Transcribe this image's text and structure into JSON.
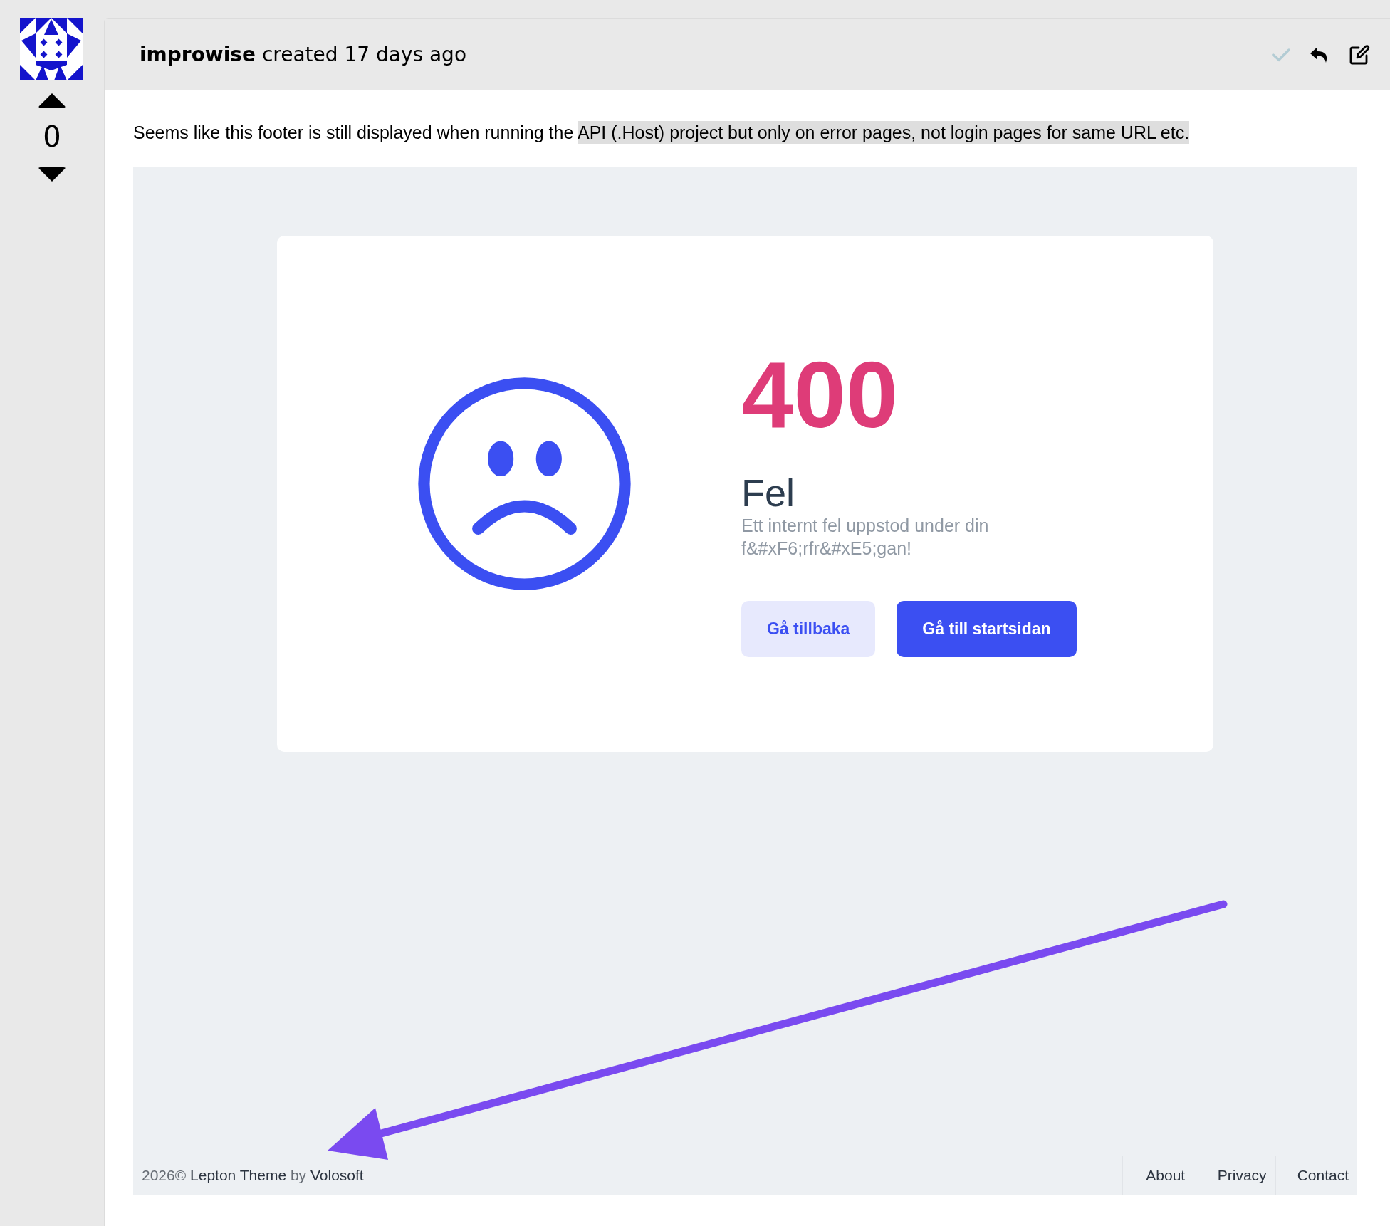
{
  "sidebar": {
    "score": "0"
  },
  "post": {
    "author": "improwise",
    "meta": "created 17 days ago",
    "accepted": false,
    "text": "Seems like this footer is still displayed when running the ",
    "highlight": "API (.Host) project but only on error pages, not login pages for same URL etc."
  },
  "screenshot": {
    "code": "400",
    "title": "Fel",
    "message": "Ett internt fel uppstod under din f&#xF6;rfr&#xE5;gan!",
    "buttons": [
      {
        "label": "Gå tillbaka",
        "kind": "secondary"
      },
      {
        "label": "Gå till startsidan",
        "kind": "primary"
      }
    ],
    "footer": {
      "year": "2026©",
      "theme": "Lepton Theme",
      "by": "by",
      "company": "Volosoft",
      "links": [
        "About",
        "Privacy",
        "Contact"
      ]
    }
  }
}
